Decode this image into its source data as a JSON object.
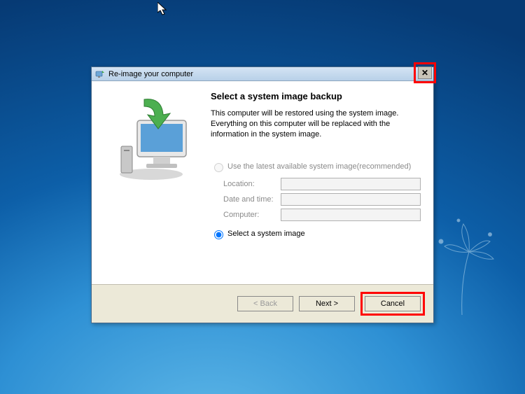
{
  "titlebar": {
    "title": "Re-image your computer",
    "close_glyph": "✕"
  },
  "content": {
    "heading": "Select a system image backup",
    "description": "This computer will be restored using the system image. Everything on this computer will be replaced with the information in the system image.",
    "radio_latest": "Use the latest available system image(recommended)",
    "radio_select": "Select a system image",
    "fields": {
      "location_label": "Location:",
      "location_value": "",
      "datetime_label": "Date and time:",
      "datetime_value": "",
      "computer_label": "Computer:",
      "computer_value": ""
    }
  },
  "buttons": {
    "back": "< Back",
    "next": "Next >",
    "cancel": "Cancel"
  }
}
